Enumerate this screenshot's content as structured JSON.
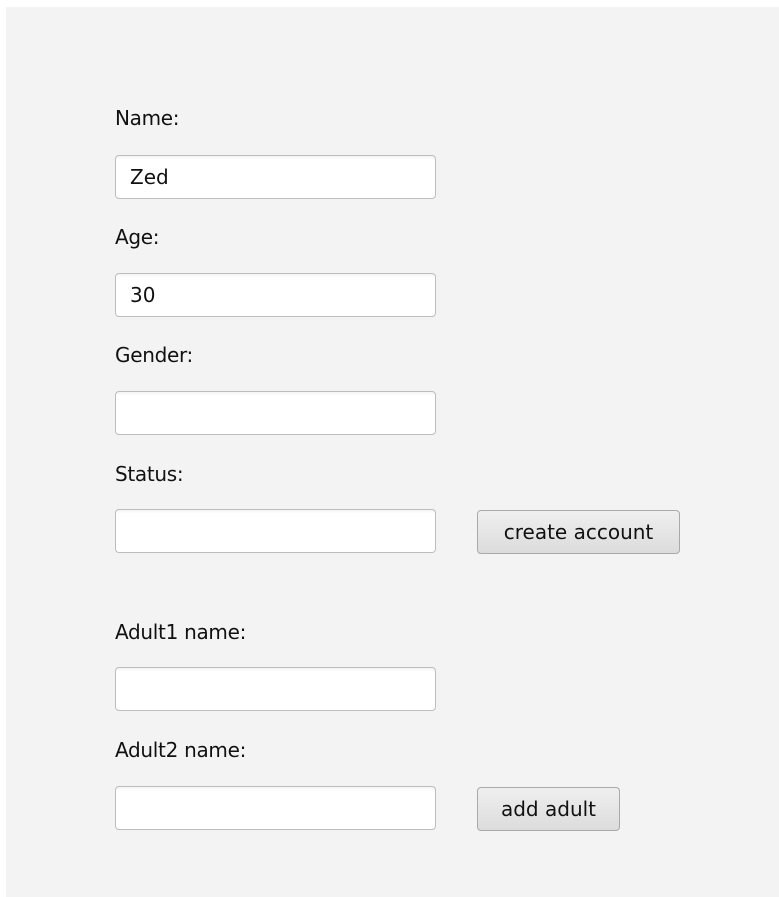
{
  "form": {
    "name_label": "Name:",
    "name_value": "Zed",
    "age_label": "Age:",
    "age_value": "30",
    "gender_label": "Gender:",
    "gender_value": "",
    "status_label": "Status:",
    "status_value": "",
    "create_account_label": "create account",
    "adult1_label": "Adult1 name:",
    "adult1_value": "",
    "adult2_label": "Adult2 name:",
    "adult2_value": "",
    "add_adult_label": "add adult"
  }
}
